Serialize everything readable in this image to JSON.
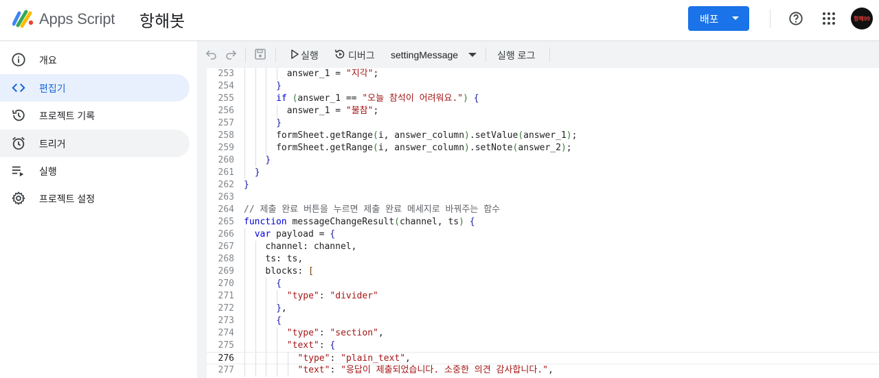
{
  "header": {
    "app_name": "Apps Script",
    "project_name": "항해봇",
    "deploy_label": "배포",
    "avatar_text": "항해99",
    "icons": [
      "apps-script-logo",
      "help-icon",
      "apps-grid-icon"
    ],
    "accent_color": "#1a73e8"
  },
  "sidebar": {
    "items": [
      {
        "label": "개요",
        "icon": "info-icon"
      },
      {
        "label": "편집기",
        "icon": "code-icon",
        "active": true
      },
      {
        "label": "프로젝트 기록",
        "icon": "history-icon"
      },
      {
        "label": "트리거",
        "icon": "alarm-icon"
      },
      {
        "label": "실행",
        "icon": "executions-icon"
      },
      {
        "label": "프로젝트 설정",
        "icon": "gear-icon"
      }
    ]
  },
  "toolbar": {
    "run_label": "실행",
    "debug_label": "디버그",
    "function_name": "settingMessage",
    "log_label": "실행 로그"
  },
  "code": {
    "current_line": 276,
    "lines": [
      {
        "n": 253,
        "indent": 4,
        "text": "answer_1 = \"지각\";"
      },
      {
        "n": 254,
        "indent": 3,
        "text": "}"
      },
      {
        "n": 255,
        "indent": 3,
        "text": "if (answer_1 == \"오늘 참석이 어려워요.\") {"
      },
      {
        "n": 256,
        "indent": 4,
        "text": "answer_1 = \"불참\";"
      },
      {
        "n": 257,
        "indent": 3,
        "text": "}"
      },
      {
        "n": 258,
        "indent": 3,
        "text": "formSheet.getRange(i, answer_column).setValue(answer_1);"
      },
      {
        "n": 259,
        "indent": 3,
        "text": "formSheet.getRange(i, answer_column).setNote(answer_2);"
      },
      {
        "n": 260,
        "indent": 2,
        "text": "}"
      },
      {
        "n": 261,
        "indent": 1,
        "text": "}"
      },
      {
        "n": 262,
        "indent": 0,
        "text": "}"
      },
      {
        "n": 263,
        "indent": 0,
        "text": ""
      },
      {
        "n": 264,
        "indent": 0,
        "text": "// 제출 완료 버튼을 누르면 제출 완료 메세지로 바꿔주는 함수"
      },
      {
        "n": 265,
        "indent": 0,
        "text": "function messageChangeResult(channel, ts) {"
      },
      {
        "n": 266,
        "indent": 1,
        "text": "var payload = {"
      },
      {
        "n": 267,
        "indent": 2,
        "text": "channel: channel,"
      },
      {
        "n": 268,
        "indent": 2,
        "text": "ts: ts,"
      },
      {
        "n": 269,
        "indent": 2,
        "text": "blocks: ["
      },
      {
        "n": 270,
        "indent": 3,
        "text": "{"
      },
      {
        "n": 271,
        "indent": 4,
        "text": "\"type\": \"divider\""
      },
      {
        "n": 272,
        "indent": 3,
        "text": "},"
      },
      {
        "n": 273,
        "indent": 3,
        "text": "{"
      },
      {
        "n": 274,
        "indent": 4,
        "text": "\"type\": \"section\","
      },
      {
        "n": 275,
        "indent": 4,
        "text": "\"text\": {"
      },
      {
        "n": 276,
        "indent": 5,
        "text": "\"type\": \"plain_text\","
      },
      {
        "n": 277,
        "indent": 5,
        "text": "\"text\": \"응답이 제출되었습니다. 소중한 의견 감사합니다.\","
      }
    ]
  }
}
